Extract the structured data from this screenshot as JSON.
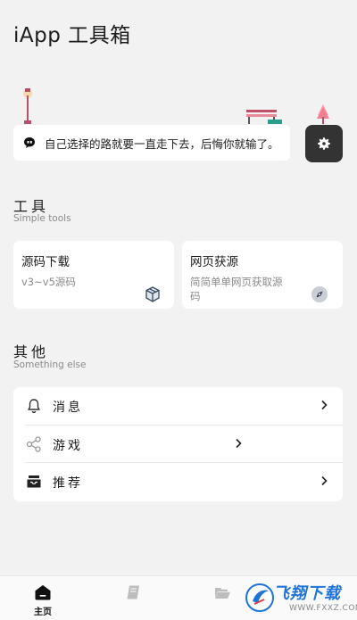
{
  "app": {
    "title": "iApp 工具箱"
  },
  "quote": {
    "text": "自己选择的路就要一直走下去，后悔你就输了。",
    "icon": "chat-quote-icon"
  },
  "settings": {
    "icon": "gear-icon"
  },
  "tools_section": {
    "title": "工具",
    "subtitle": "Simple tools",
    "cards": [
      {
        "title": "源码下载",
        "desc": "v3~v5源码",
        "icon": "package-icon"
      },
      {
        "title": "网页获源",
        "desc_line1": "简简单单网页获取源",
        "desc_line2": "码",
        "icon": "compass-icon"
      }
    ]
  },
  "other_section": {
    "title": "其他",
    "subtitle": "Something else",
    "items": [
      {
        "label": "消息",
        "icon": "bell-icon"
      },
      {
        "label": "游戏",
        "icon": "share-icon"
      },
      {
        "label": "推荐",
        "icon": "inbox-icon"
      }
    ]
  },
  "bottom_nav": {
    "items": [
      {
        "label": "主页",
        "icon": "home-icon",
        "active": true
      },
      {
        "label": "",
        "icon": "book-icon",
        "active": false
      },
      {
        "label": "",
        "icon": "folder-icon",
        "active": false
      }
    ]
  },
  "watermark": {
    "text": "飞翔下载",
    "url": "WWW.FXXZ.COM"
  },
  "colors": {
    "background": "#f2f2f2",
    "card": "#ffffff",
    "settings_button": "#333333",
    "watermark": "#1e73d8"
  }
}
